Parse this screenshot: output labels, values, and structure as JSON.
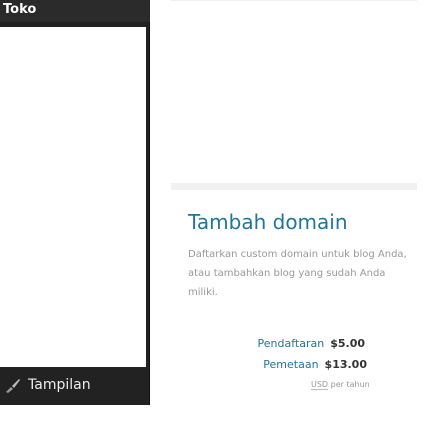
{
  "sidebar": {
    "top_label": "Toko",
    "bottom_item": {
      "label": "Tampilan",
      "icon": "brush-icon"
    }
  },
  "card": {
    "title": "Tambah domain",
    "description": "Daftarkan custom domain untuk blog Anda, atau tambahkan blog yang sudah Anda miliki.",
    "prices": [
      {
        "label": "Pendaftaran",
        "value": "$5.00"
      },
      {
        "label": "Pemetaan",
        "value": "$13.00"
      }
    ],
    "note_currency": "USD",
    "note_period": "per tahun"
  },
  "colors": {
    "sidebar_bg": "#222222",
    "title_blue": "#21759b",
    "muted_text": "#999999"
  }
}
